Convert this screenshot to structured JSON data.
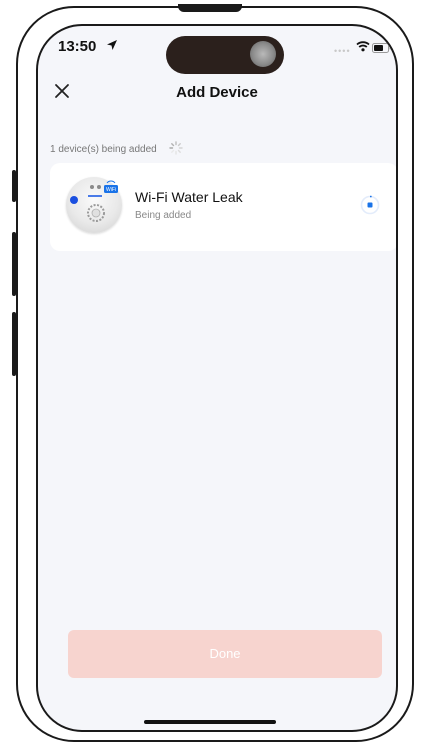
{
  "status_bar": {
    "time": "13:50"
  },
  "nav": {
    "title": "Add Device",
    "close_icon": "close-icon"
  },
  "adding": {
    "text": "1 device(s) being added"
  },
  "device": {
    "name": "Wi-Fi Water Leak",
    "status": "Being added",
    "badge": "WiFi"
  },
  "done_button": {
    "label": "Done"
  },
  "colors": {
    "done_button_bg": "#f7d4cf",
    "accent": "#1a73e8",
    "screen_bg": "#f5f6fa"
  }
}
